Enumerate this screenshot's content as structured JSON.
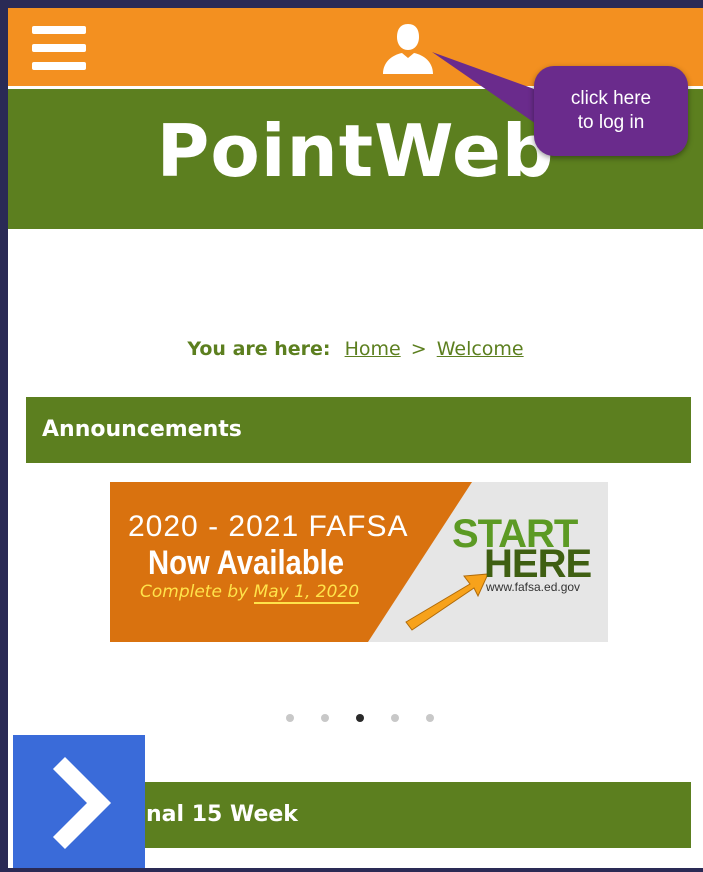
{
  "header": {
    "menu_icon": "hamburger-menu-icon",
    "user_icon": "user-login-icon",
    "color": "#f39020"
  },
  "callout": {
    "line1": "click here",
    "line2": "to log in",
    "color": "#6a2b8c"
  },
  "banner": {
    "logo": "PointWeb",
    "color": "#5c7f1f"
  },
  "breadcrumb": {
    "label": "You are here:",
    "home": "Home",
    "separator": ">",
    "current": "Welcome"
  },
  "announcements": {
    "title": "Announcements"
  },
  "slide": {
    "line1": "2020 - 2021  FAFSA",
    "line2": "Now Available",
    "line3_prefix": "Complete by ",
    "line3_date": "May 1, 2020",
    "start": "START",
    "here": "HERE",
    "url": "www.fafsa.ed.gov"
  },
  "carousel": {
    "total": 5,
    "active_index": 2
  },
  "next_section": {
    "title_visible": "nal 15 Week"
  },
  "next_button": {
    "icon": "chevron-right-icon",
    "color": "#3a6bd9"
  }
}
